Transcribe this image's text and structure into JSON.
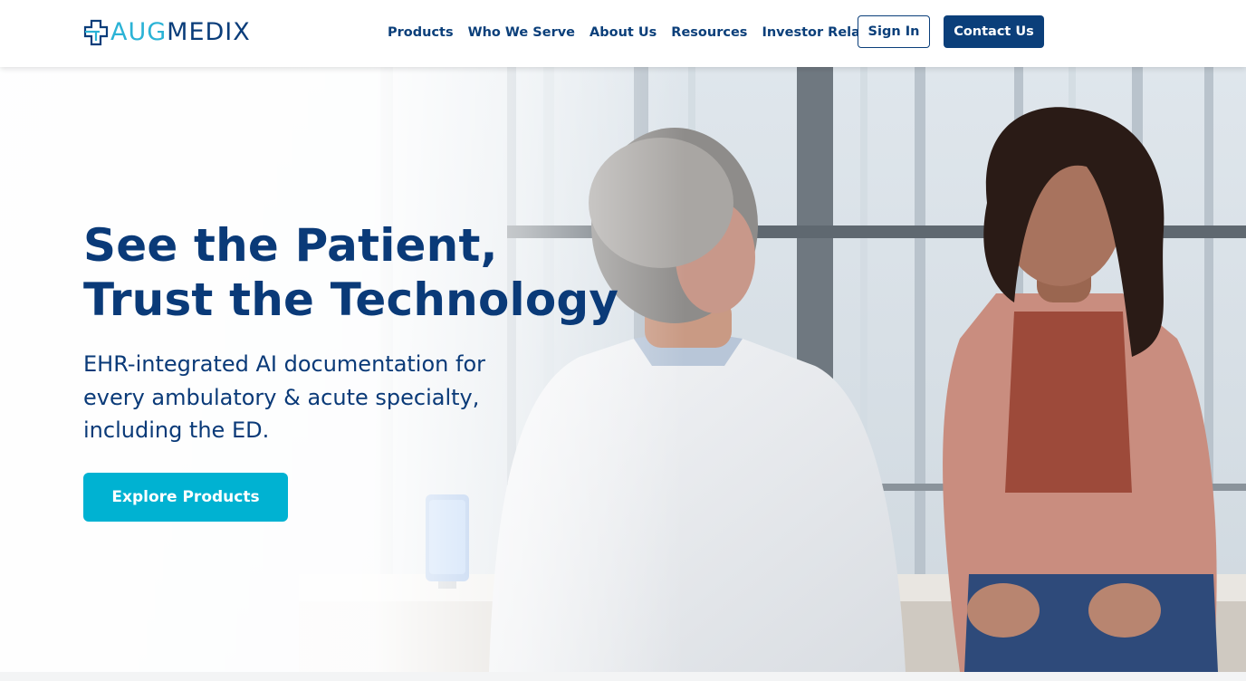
{
  "header": {
    "logo": {
      "part1": "AUG",
      "part2": "MEDIX"
    },
    "nav": [
      {
        "label": "Products"
      },
      {
        "label": "Who We Serve"
      },
      {
        "label": "About Us"
      },
      {
        "label": "Resources"
      },
      {
        "label": "Investor Relations"
      }
    ],
    "sign_in_label": "Sign In",
    "contact_label": "Contact Us"
  },
  "hero": {
    "headline_line1": "See the Patient,",
    "headline_line2": "Trust the Technology",
    "subheadline": "EHR-integrated AI documentation for every ambulatory & acute specialty, including the ED.",
    "cta_label": "Explore Products",
    "image_description_icon": "clinician-patient-photo"
  },
  "colors": {
    "brand_navy": "#0b3f7a",
    "brand_cyan": "#00b2d2",
    "logo_cyan": "#2bb3d6"
  }
}
